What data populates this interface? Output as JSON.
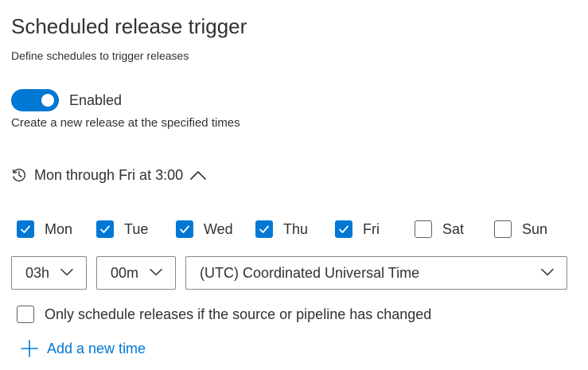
{
  "header": {
    "title": "Scheduled release trigger",
    "subtitle": "Define schedules to trigger releases"
  },
  "toggle": {
    "state": true,
    "label": "Enabled",
    "description": "Create a new release at the specified times"
  },
  "schedule": {
    "summary": "Mon through Fri at 3:00",
    "icon": "history-clock-icon",
    "expanded": true,
    "days": [
      {
        "label": "Mon",
        "checked": true
      },
      {
        "label": "Tue",
        "checked": true
      },
      {
        "label": "Wed",
        "checked": true
      },
      {
        "label": "Thu",
        "checked": true
      },
      {
        "label": "Fri",
        "checked": true
      },
      {
        "label": "Sat",
        "checked": false
      },
      {
        "label": "Sun",
        "checked": false
      }
    ],
    "hour": "03h",
    "minute": "00m",
    "timezone": "(UTC) Coordinated Universal Time",
    "only_if_changed_label": "Only schedule releases if the source or pipeline has changed",
    "only_if_changed_checked": false
  },
  "add_time": {
    "label": "Add a new time"
  },
  "colors": {
    "accent": "#0078d4",
    "text": "#323130",
    "border": "#8a8886"
  }
}
